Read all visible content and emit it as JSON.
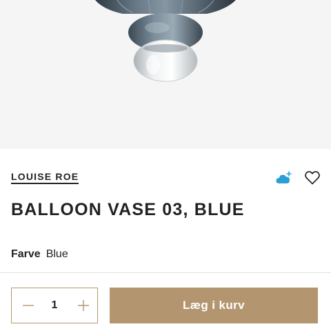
{
  "product": {
    "brand": "LOUISE ROE",
    "title": "BALLOON VASE 03, BLUE",
    "image_icon": "vase-image"
  },
  "actions": {
    "cloud_icon": "cloud-plus-icon",
    "wishlist_icon": "heart-icon"
  },
  "color": {
    "label": "Farve",
    "value": "Blue"
  },
  "cart": {
    "quantity": "1",
    "add_label": "Læg i kurv",
    "minus_icon": "minus-icon",
    "plus_icon": "plus-icon"
  },
  "colors": {
    "accent": "#b39670",
    "cloud": "#2a9fd6",
    "hero_bg": "#f5f5f5",
    "text": "#222222"
  }
}
